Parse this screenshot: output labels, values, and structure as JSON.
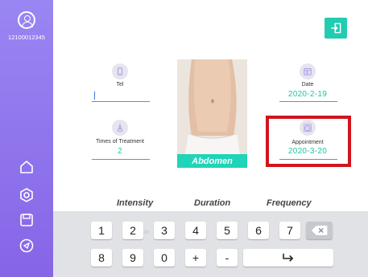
{
  "sidebar": {
    "user_id": "12100012345"
  },
  "fields": {
    "tel": {
      "label": "Tel",
      "value": ""
    },
    "date": {
      "label": "Date",
      "value": "2020-2-19"
    },
    "times": {
      "label": "Times of Treatment",
      "value": "2"
    },
    "appointment": {
      "label": "Appointment",
      "value": "2020-3-20"
    }
  },
  "body_area": "Abdomen",
  "tabs": [
    "Intensity",
    "Duration",
    "Frequency"
  ],
  "keyboard": {
    "row1": [
      "1",
      "2",
      "3",
      "4",
      "5",
      "6",
      "7"
    ],
    "row2": [
      "8",
      "9",
      "0",
      "+",
      "-"
    ],
    "backspace_icon": "backspace-icon",
    "enter_icon": "enter-icon"
  },
  "colors": {
    "accent": "#22ccb0",
    "highlight": "#d0151e",
    "sidebar": "#9a86f2"
  }
}
